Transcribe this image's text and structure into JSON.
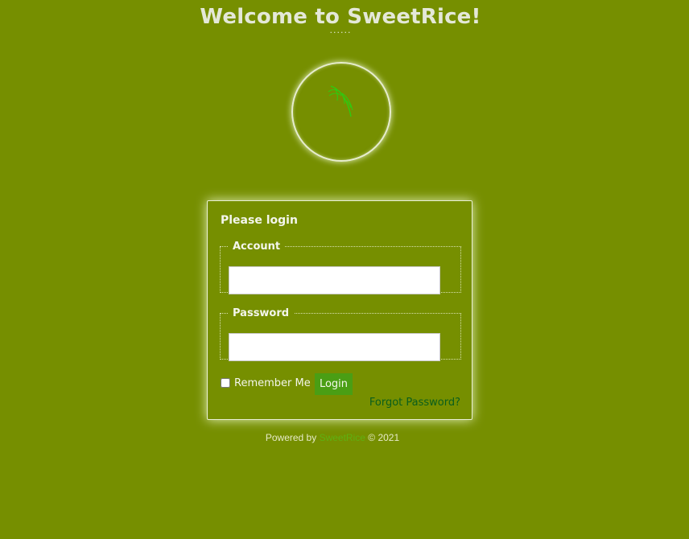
{
  "header": {
    "title": "Welcome to SweetRice!",
    "dots": "......"
  },
  "logo": {
    "icon": "rice-plant-icon",
    "accent_color": "#33cc11"
  },
  "login": {
    "heading": "Please login",
    "account_legend": "Account",
    "account_value": "",
    "password_legend": "Password",
    "password_value": "",
    "remember_label": "Remember Me",
    "remember_checked": false,
    "login_button": "Login",
    "forgot_link": "Forgot Password?"
  },
  "footer": {
    "powered_by": "Powered by",
    "brand": "SweetRice",
    "copyright": "© 2021"
  },
  "colors": {
    "background": "#768f00",
    "button": "#4a9e14",
    "link": "#0a5e1c"
  }
}
